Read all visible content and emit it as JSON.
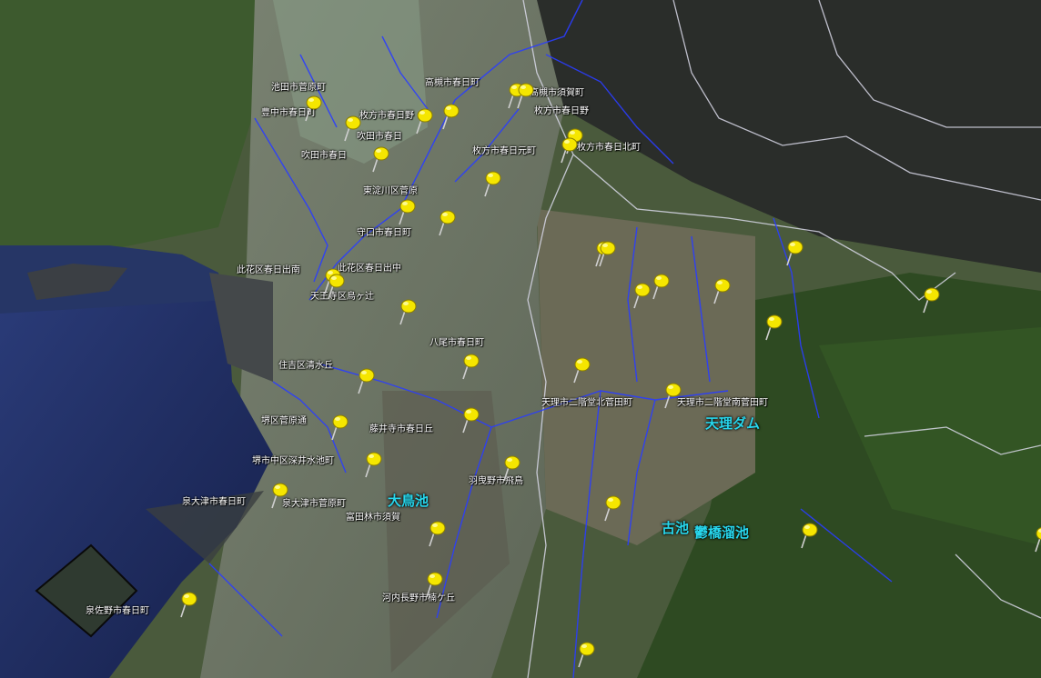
{
  "colors": {
    "rivers": "#2a3dff",
    "boundaries": "#d8d8e8",
    "pins": "#f5e600",
    "feature_label": "#27d6ec",
    "place_label": "#ffffff",
    "sea": "#1f2f66"
  },
  "place_labels": [
    "池田市菅原町",
    "豊中市春日町",
    "枚方市春日野",
    "高槻市春日町",
    "高槻市須賀町",
    "枚方市春日野",
    "吹田市春日",
    "吹田市春日",
    "枚方市春日元町",
    "枚方市春日北町",
    "東淀川区菅原",
    "守口市春日町",
    "此花区春日出南",
    "此花区春日出中",
    "天王寺区烏ヶ辻",
    "八尾市春日町",
    "住吉区清水丘",
    "天理市二階堂北菅田町",
    "天理市二階堂南菅田町",
    "堺区菅原通",
    "藤井寺市春日丘",
    "堺市中区深井水池町",
    "羽曳野市飛鳥",
    "泉大津市春日町",
    "泉大津市菅原町",
    "富田林市須賀",
    "河内長野市楠ケ丘",
    "泉佐野市春日町"
  ],
  "feature_labels": [
    "大鳥池",
    "天理ダム",
    "古池",
    "鬱橋溜池"
  ],
  "pin_icon": "yellow-pushpin-icon"
}
